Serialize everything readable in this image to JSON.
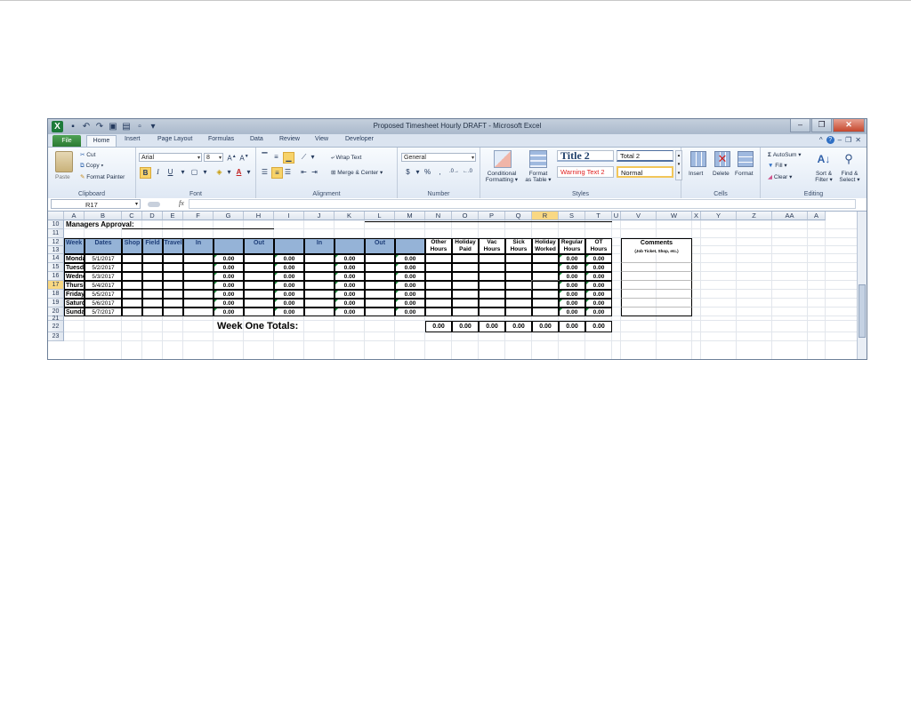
{
  "window": {
    "title": "Proposed Timesheet Hourly DRAFT - Microsoft Excel",
    "app_icon": "X"
  },
  "tabs": [
    "File",
    "Home",
    "Insert",
    "Page Layout",
    "Formulas",
    "Data",
    "Review",
    "View",
    "Developer"
  ],
  "ribbon": {
    "clipboard": {
      "label": "Clipboard",
      "paste": "Paste",
      "cut": "Cut",
      "copy": "Copy",
      "format_painter": "Format Painter"
    },
    "font": {
      "label": "Font",
      "font_name": "Arial",
      "font_size": "8",
      "bold": "B",
      "italic": "I",
      "underline": "U"
    },
    "alignment": {
      "label": "Alignment",
      "wrap_text": "Wrap Text",
      "merge_center": "Merge & Center"
    },
    "number": {
      "label": "Number",
      "format": "General",
      "currency": "$",
      "percent": "%",
      "comma": ","
    },
    "styles": {
      "label": "Styles",
      "conditional": [
        "Conditional",
        "Formatting"
      ],
      "format_table": [
        "Format",
        "as Table"
      ],
      "title2": "Title 2",
      "total2": "Total 2",
      "warning": "Warning Text 2",
      "normal": "Normal"
    },
    "cells": {
      "label": "Cells",
      "insert": "Insert",
      "delete": "Delete",
      "format": "Format"
    },
    "editing": {
      "label": "Editing",
      "autosum": "AutoSum",
      "fill": "Fill",
      "clear": "Clear",
      "sort": [
        "Sort &",
        "Filter"
      ],
      "find": [
        "Find &",
        "Select"
      ]
    }
  },
  "formula_bar": {
    "name_box": "R17",
    "fx": "fx",
    "formula": ""
  },
  "columns": [
    "A",
    "B",
    "C",
    "D",
    "E",
    "F",
    "G",
    "H",
    "I",
    "J",
    "K",
    "L",
    "M",
    "N",
    "O",
    "P",
    "Q",
    "R",
    "S",
    "T",
    "U",
    "V",
    "W",
    "X",
    "Y",
    "Z",
    "AA",
    "A"
  ],
  "selected_column": "R",
  "rows": [
    "10",
    "11",
    "12",
    "13",
    "14",
    "15",
    "16",
    "17",
    "18",
    "19",
    "20",
    "21",
    "22",
    "23"
  ],
  "selected_row": "17",
  "sheet": {
    "managers_approval": "Managers Approval:",
    "headers": {
      "week_one": "Week One",
      "dates": "Dates",
      "shop": "Shop",
      "field": "Field",
      "travel": "Travel",
      "in1": "In",
      "out1": "Out",
      "in2": "In",
      "out2": "Out",
      "other": [
        "Other",
        "Hours"
      ],
      "holiday_paid": [
        "Holiday",
        "Paid"
      ],
      "vac": [
        "Vac",
        "Hours"
      ],
      "sick": [
        "Sick",
        "Hours"
      ],
      "holiday_worked": [
        "Holiday",
        "Worked"
      ],
      "regular": [
        "Regular",
        "Hours"
      ],
      "ot": [
        "OT",
        "Hours"
      ],
      "comments": "Comments",
      "comments_sub": "(Job Ticket, Shop, etc.)"
    },
    "days": [
      {
        "day": "Monday",
        "date": "5/1/2017",
        "g": "0.00",
        "i": "0.00",
        "k": "0.00",
        "m": "0.00",
        "reg": "0.00",
        "ot": "0.00"
      },
      {
        "day": "Tuesday",
        "date": "5/2/2017",
        "g": "0.00",
        "i": "0.00",
        "k": "0.00",
        "m": "0.00",
        "reg": "0.00",
        "ot": "0.00"
      },
      {
        "day": "Wednesday",
        "date": "5/3/2017",
        "g": "0.00",
        "i": "0.00",
        "k": "0.00",
        "m": "0.00",
        "reg": "0.00",
        "ot": "0.00"
      },
      {
        "day": "Thursday",
        "date": "5/4/2017",
        "g": "0.00",
        "i": "0.00",
        "k": "0.00",
        "m": "0.00",
        "reg": "0.00",
        "ot": "0.00"
      },
      {
        "day": "Friday",
        "date": "5/5/2017",
        "g": "0.00",
        "i": "0.00",
        "k": "0.00",
        "m": "0.00",
        "reg": "0.00",
        "ot": "0.00"
      },
      {
        "day": "Saturday",
        "date": "5/6/2017",
        "g": "0.00",
        "i": "0.00",
        "k": "0.00",
        "m": "0.00",
        "reg": "0.00",
        "ot": "0.00"
      },
      {
        "day": "Sunday",
        "date": "5/7/2017",
        "g": "0.00",
        "i": "0.00",
        "k": "0.00",
        "m": "0.00",
        "reg": "0.00",
        "ot": "0.00"
      }
    ],
    "totals_label": "Week One Totals:",
    "totals": [
      "0.00",
      "0.00",
      "0.00",
      "0.00",
      "0.00",
      "0.00",
      "0.00"
    ]
  }
}
